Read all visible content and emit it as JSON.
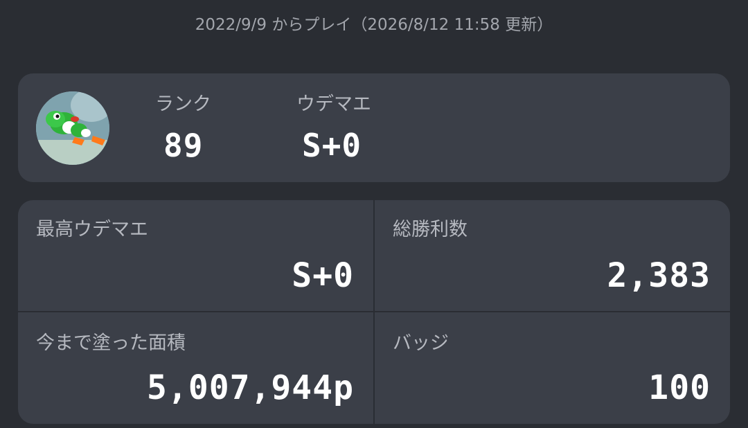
{
  "header": {
    "subtitle": "2022/9/9 からプレイ（2026/8/12 11:58 更新）"
  },
  "profile": {
    "avatar_icon": "yoshi-avatar-icon",
    "rank_label": "ランク",
    "rank_value": "89",
    "udemae_label": "ウデマエ",
    "udemae_value": "S+0"
  },
  "stats": {
    "max_udemae_label": "最高ウデマエ",
    "max_udemae_value": "S+0",
    "total_wins_label": "総勝利数",
    "total_wins_value": "2,383",
    "painted_area_label": "今まで塗った面積",
    "painted_area_value": "5,007,944p",
    "badges_label": "バッジ",
    "badges_value": "100"
  },
  "colors": {
    "background": "#2a2d33",
    "card": "#3b3f48",
    "label": "#b6b9c0",
    "value": "#ffffff"
  }
}
